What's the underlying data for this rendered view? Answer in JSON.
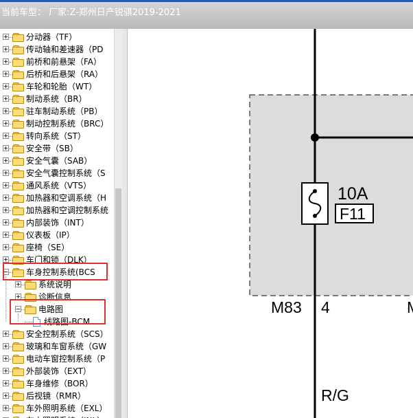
{
  "title_bar": {
    "text": "当前车型： 厂家:Z-郑州日产锐骐2019-2021"
  },
  "tree": {
    "items": [
      {
        "label": "分动器（TF）"
      },
      {
        "label": "传动轴和差速器（PD"
      },
      {
        "label": "前桥和前悬架（FA）"
      },
      {
        "label": "后桥和后悬架（RA）"
      },
      {
        "label": "车轮和轮胎（WT）"
      },
      {
        "label": "制动系统（BR）"
      },
      {
        "label": "驻车制动系统（PB）"
      },
      {
        "label": "制动控制系统（BRC）"
      },
      {
        "label": "转向系统（ST）"
      },
      {
        "label": "安全带（SB）"
      },
      {
        "label": "安全气囊（SAB）"
      },
      {
        "label": "安全气囊控制系统（S"
      },
      {
        "label": "通风系统（VTS）"
      },
      {
        "label": "加热器和空调系统（H"
      },
      {
        "label": "加热器和空调控制系统"
      },
      {
        "label": "内部装饰（INT）"
      },
      {
        "label": "仪表板（IP）"
      },
      {
        "label": "座椅（SE）"
      },
      {
        "label": "车门和锁（DLK）"
      },
      {
        "label": "车身控制系统(BCS"
      },
      {
        "label": "系统说明"
      },
      {
        "label": "诊断信息"
      },
      {
        "label": "电路图"
      },
      {
        "label": "线路图-BCM"
      },
      {
        "label": "安全控制系统（SCS）"
      },
      {
        "label": "玻璃和车窗系统（GW"
      },
      {
        "label": "电动车窗控制系统（P"
      },
      {
        "label": "外部装饰（EXT）"
      },
      {
        "label": "车身维修（BOR）"
      },
      {
        "label": "后视镜（RMR）"
      },
      {
        "label": "车外照明系统（EXL）"
      },
      {
        "label": "车内照明系统（INL）"
      }
    ]
  },
  "diagram": {
    "fuse_rating": "10A",
    "fuse_id": "F11",
    "connector": "M83",
    "pin": "4",
    "connector_right": "M",
    "wire_color": "R/G"
  },
  "colors": {
    "highlight": "#e03030",
    "fuse_zone": "#dcdcdc"
  }
}
